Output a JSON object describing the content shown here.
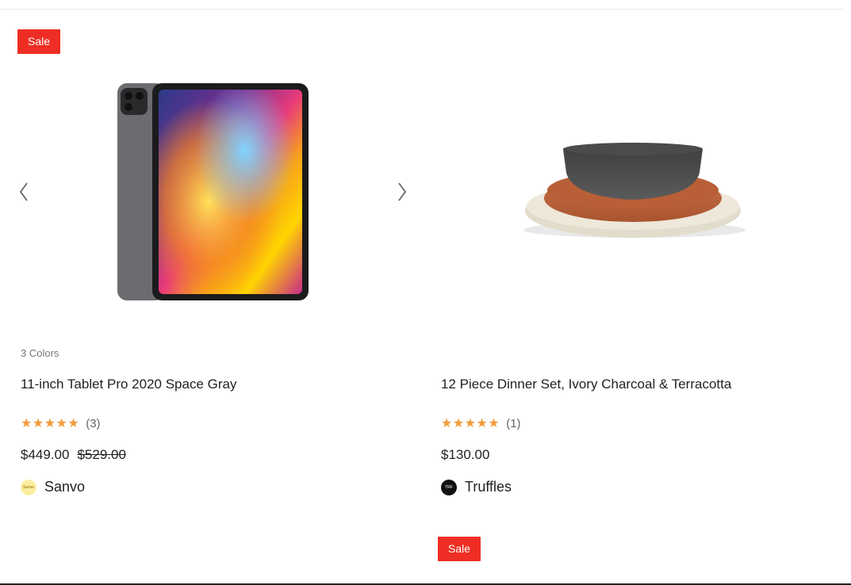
{
  "products": [
    {
      "badge": "Sale",
      "colors": "3 Colors",
      "title": "11-inch Tablet Pro 2020 Space Gray",
      "stars": "★★★★★",
      "rating_count": "(3)",
      "rating": 5,
      "price": "$449.00",
      "old_price": "$529.00",
      "vendor": "Sanvo",
      "vendor_logo_text": "Sanvo"
    },
    {
      "title": "12 Piece Dinner Set, Ivory Charcoal & Terracotta",
      "stars": "★★★★★",
      "rating_count": "(1)",
      "rating": 5,
      "price": "$130.00",
      "vendor": "Truffles",
      "vendor_logo_text": "TRF"
    }
  ],
  "next_badge": "Sale",
  "colors": {
    "sale_badge": "#ee2e24",
    "stars": "#f29b38"
  },
  "icons": {
    "prev": "chevron-left-icon",
    "next": "chevron-right-icon"
  }
}
